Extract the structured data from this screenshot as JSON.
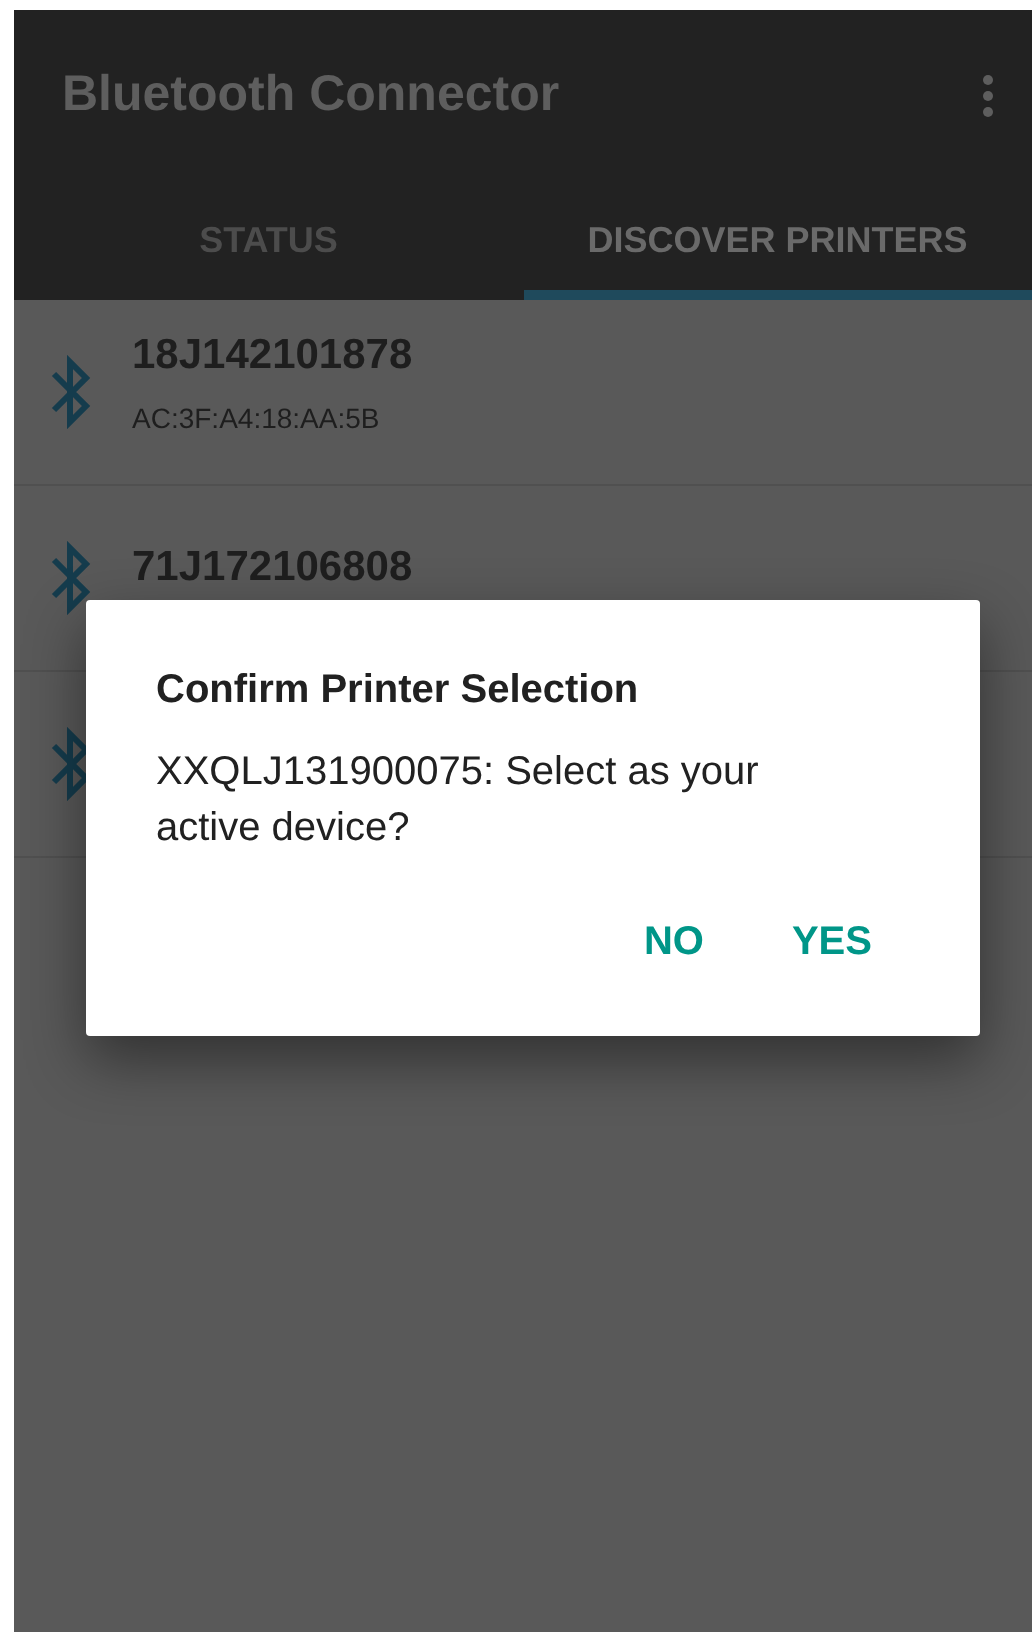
{
  "app_bar": {
    "title": "Bluetooth Connector"
  },
  "tabs": [
    {
      "label": "STATUS",
      "selected": false
    },
    {
      "label": "DISCOVER PRINTERS",
      "selected": true
    }
  ],
  "devices": [
    {
      "kind": "listed",
      "name": "18J142101878",
      "address": "AC:3F:A4:18:AA:5B"
    },
    {
      "kind": "listed",
      "name": "71J172106808"
    },
    {
      "kind": "covered"
    }
  ],
  "dialog": {
    "title": "Confirm Printer Selection",
    "message": "XXQLJ131900075: Select as your active device?",
    "buttons": [
      "NO",
      "YES"
    ]
  }
}
